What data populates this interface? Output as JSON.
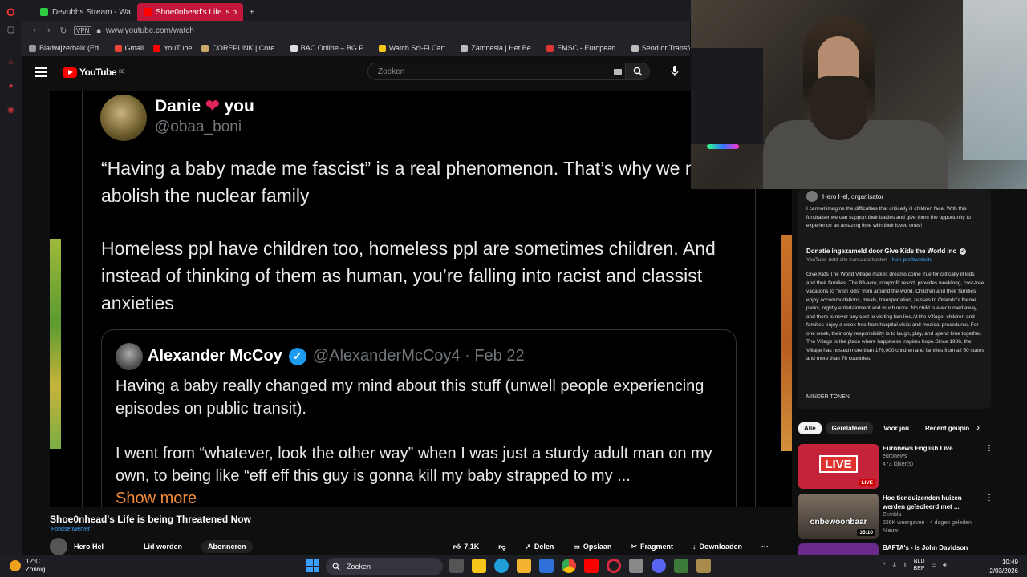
{
  "browser": {
    "tabs": [
      {
        "label": "Devubbs Stream - Wa",
        "active": false
      },
      {
        "label": "Shoe0nhead's Life is b",
        "active": true
      }
    ],
    "new_tab": "+",
    "vpn_label": "VPN",
    "url": "www.youtube.com/watch",
    "bookmarks": [
      "Bladwijzerbalk (Ed...",
      "Gmail",
      "YouTube",
      "COREPUNK | Core...",
      "BAC Online – BG P...",
      "Watch Sci-Fi Cart...",
      "Zamnesia | Het Be...",
      "EMSC - European...",
      "Send or Transfer..."
    ]
  },
  "youtube": {
    "logo_text": "YouTube",
    "logo_country": "BE",
    "search_placeholder": "Zoeken"
  },
  "tweet": {
    "name": "Danie",
    "name_suffix": "you",
    "handle": "@obaa_boni",
    "paragraphs": [
      "“Having a baby made me fascist” is a real phenomenon. That’s why we must abolish the nuclear family",
      "Homeless ppl have children too, homeless ppl are sometimes children. And instead of thinking of them as human, you’re falling into racist and classist anxieties"
    ],
    "quoted": {
      "name": "Alexander McCoy",
      "handle_date": "@AlexanderMcCoy4 · Feb 22",
      "paragraphs": [
        "Having a baby really changed my mind about this stuff (unwell people experiencing episodes on public transit).",
        "I went from “whatever, look the other way” when I was just a sturdy adult man on my own, to being like “eff eff this guy is gonna kill my baby strapped to my ..."
      ],
      "show_more": "Show more"
    }
  },
  "video": {
    "title": "Shoe0nhead's Life is being Threatened Now",
    "fundraiser": "Fondsenwerver",
    "channel": "Hero Hel",
    "join": "Lid worden",
    "subscribe": "Abonneren",
    "likes": "7,1K",
    "share": "Delen",
    "save": "Opslaan",
    "clip": "Fragment",
    "download": "Downloaden",
    "more": "···"
  },
  "donation": {
    "organizer": "Hero Hel, organisator",
    "intro": "I cannot imagine the difficulties that critically ill children face. With this fundraiser we can support their battles and give them the opportunity to experience an amazing time with their loved ones!",
    "title": "Donatie ingezameld door Give Kids the World Inc",
    "sub": "YouTube dekt alle transactiekosten",
    "sub_link": "Non-profitwebsite",
    "description": "Give Kids The World Village makes dreams come true for critically ill kids and their families. The 89-acre, nonprofit resort, provides weeklong, cost-free vacations to \"wish kids\" from around the world. Children and their families enjoy accommodations, meals, transportation, passes to Orlando's theme parks, nightly entertainment and much more. No child is ever turned away, and there is never any cost to visiting families.At the Village, children and families enjoy a week free from hospital visits and medical procedures. For one week, their only responsibility is to laugh, play, and spend time together. The Village is the place where happiness inspires hope.Since 1986, the Village has hosted more than 176,000 children and families from all 50 states and more than 76 countries.",
    "less": "MINDER TONEN"
  },
  "chips": [
    "Alle",
    "Gerelateerd",
    "Voor jou",
    "Recent geüplo"
  ],
  "recommendations": [
    {
      "title": "Euronews English Live",
      "channel": "euronews",
      "stats": "473 kijker(s)",
      "badge": "LIVE",
      "thumb_text": "LIVE"
    },
    {
      "title": "Hoe tienduizenden huizen werden geïsoleerd met ...",
      "channel": "Zembla",
      "stats": "226K weergaven · 4 dagen geleden",
      "extra": "Nieuw",
      "badge": "35:10",
      "thumb_text": "onbewoonbaar"
    },
    {
      "title": "BAFTA's - Is John Davidson",
      "channel": "",
      "stats": "",
      "badge": "",
      "thumb_text": ""
    }
  ],
  "taskbar": {
    "temp": "12°C",
    "weather": "Zonnig",
    "search": "Zoeken",
    "lang": "NLD",
    "lang2": "BEP",
    "time": "10:49",
    "date": "2/03/2026"
  },
  "colors": {
    "accent": "#c2163a",
    "yt_red": "#ff0000",
    "link": "#3ea6ff",
    "verified": "#1d9bf0",
    "heart": "#e0245e"
  }
}
